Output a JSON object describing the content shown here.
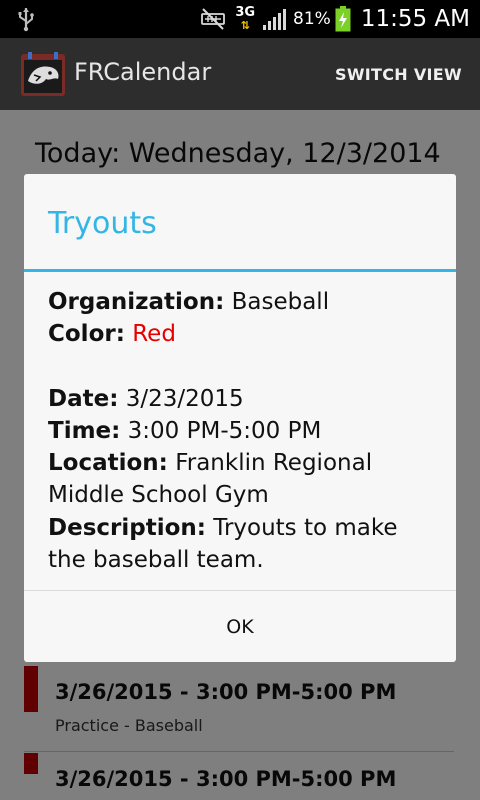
{
  "status_bar": {
    "battery_percent": "81%",
    "network": "3G",
    "time": "11:55 AM",
    "icons": [
      "usb-icon",
      "mute-icon",
      "network-3g-icon",
      "signal-icon",
      "battery-charging-icon"
    ]
  },
  "action_bar": {
    "title": "FRCalendar",
    "switch_view": "SWITCH VIEW",
    "icon": "app-logo-icon"
  },
  "content": {
    "today": "Today: Wednesday, 12/3/2014",
    "events": [
      {
        "date": "3/26/2015 - 3:00 PM-5:00 PM",
        "subtitle": "Practice - Baseball",
        "color": "#c00000"
      },
      {
        "date": "3/26/2015 - 3:00 PM-5:00 PM",
        "subtitle": "",
        "color": "#c00000"
      }
    ]
  },
  "dialog": {
    "title": "Tryouts",
    "accent_color": "#33b5e5",
    "organization_label": "Organization:",
    "organization_value": "Baseball",
    "color_label": "Color:",
    "color_value": "Red",
    "color_value_hex": "#e50000",
    "date_label": "Date:",
    "date_value": "3/23/2015",
    "time_label": "Time:",
    "time_value": "3:00 PM-5:00 PM",
    "location_label": "Location:",
    "location_value_line1": "Franklin Regional",
    "location_value_line2": "Middle School Gym",
    "description_label": "Description:",
    "description_value_line1": "Tryouts to make",
    "description_value_line2": "the baseball team.",
    "ok_label": "OK"
  }
}
